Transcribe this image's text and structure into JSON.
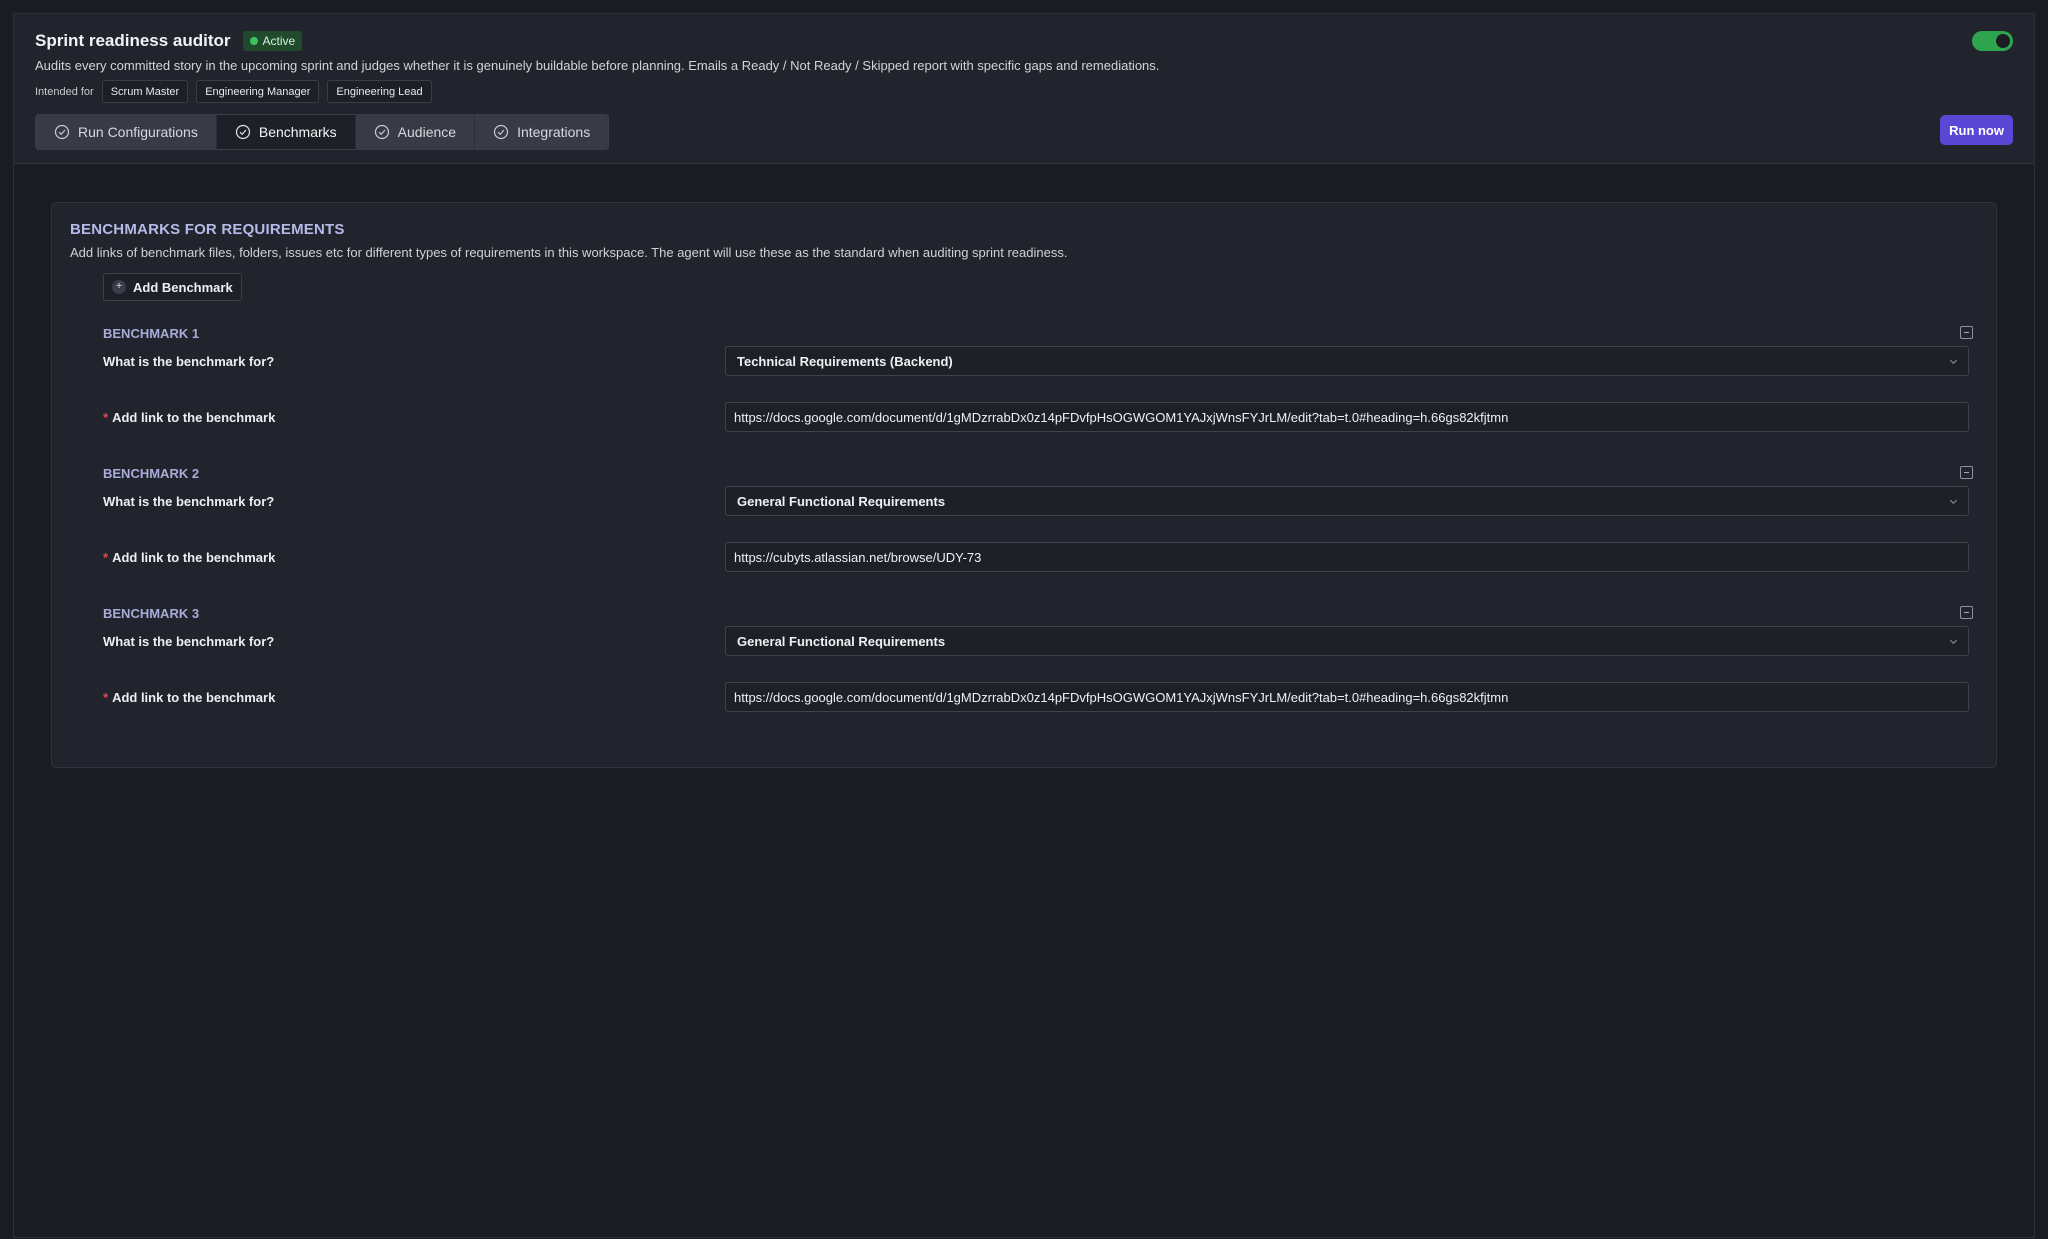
{
  "agent": {
    "title": "Sprint readiness auditor",
    "status": "Active",
    "description": "Audits every committed story in the upcoming sprint and judges whether it is genuinely buildable before planning. Emails a Ready / Not Ready / Skipped report with specific gaps and remediations.",
    "intended_for_label": "Intended for",
    "audiences": [
      "Scrum Master",
      "Engineering Manager",
      "Engineering Lead"
    ],
    "enabled": true
  },
  "tabs": [
    {
      "label": "Run Configurations",
      "active": false
    },
    {
      "label": "Benchmarks",
      "active": true
    },
    {
      "label": "Audience",
      "active": false
    },
    {
      "label": "Integrations",
      "active": false
    }
  ],
  "run_button": "Run now",
  "panel": {
    "title": "BENCHMARKS FOR REQUIREMENTS",
    "subtitle": "Add links of benchmark files, folders, issues etc for different types of requirements in this workspace. The agent will use these as the standard when auditing sprint readiness.",
    "add_button": "Add Benchmark",
    "question_label": "What is the benchmark for?",
    "link_label": "Add link to the benchmark"
  },
  "benchmarks": [
    {
      "heading": "BENCHMARK 1",
      "type": "Technical Requirements (Backend)",
      "link": "https://docs.google.com/document/d/1gMDzrrabDx0z14pFDvfpHsOGWGOM1YAJxjWnsFYJrLM/edit?tab=t.0#heading=h.66gs82kfjtmn"
    },
    {
      "heading": "BENCHMARK 2",
      "type": "General Functional Requirements",
      "link": "https://cubyts.atlassian.net/browse/UDY-73"
    },
    {
      "heading": "BENCHMARK 3",
      "type": "General Functional Requirements",
      "link": "https://docs.google.com/document/d/1gMDzrrabDx0z14pFDvfpHsOGWGOM1YAJxjWnsFYJrLM/edit?tab=t.0#heading=h.66gs82kfjtmn"
    }
  ],
  "colors": {
    "accent": "#5b47d6",
    "active": "#3ec35c",
    "heading": "#b7b9e8",
    "required": "#e5484d"
  }
}
